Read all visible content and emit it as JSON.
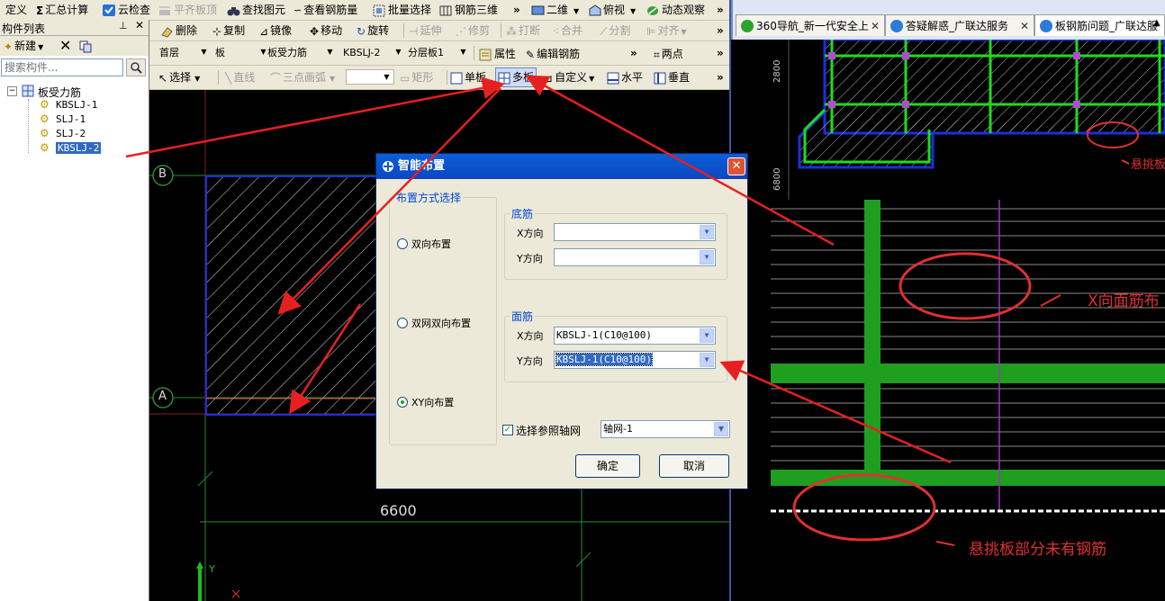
{
  "toolbar_top": {
    "define": "定义",
    "summary_calc": "汇总计算",
    "cloud_check": "云检查",
    "flat_top": "平齐板顶",
    "find_element": "查找图元",
    "view_rebar_qty": "查看钢筋量",
    "batch_select": "批量选择",
    "rebar_3d": "钢筋三维",
    "view_2d": "二维",
    "top_view": "俯视",
    "dynamic_view": "动态观察"
  },
  "toolbar_edit": {
    "delete": "删除",
    "copy": "复制",
    "mirror": "镜像",
    "move": "移动",
    "rotate": "旋转",
    "extend": "延伸",
    "trim": "修剪",
    "break": "打断",
    "merge": "合并",
    "split": "分割",
    "align": "对齐"
  },
  "toolbar_select": {
    "floor": "首层",
    "element_type": "板",
    "element_sub": "板受力筋",
    "element_name": "KBSLJ-2",
    "layer": "分层板1",
    "properties": "属性",
    "edit_rebar": "编辑钢筋",
    "two_points": "两点"
  },
  "toolbar_draw": {
    "select": "选择",
    "line": "直线",
    "three_point_arc": "三点画弧",
    "rect": "矩形",
    "single_slab": "单板",
    "multi_slab": "多板",
    "custom": "自定义",
    "horizontal": "水平",
    "vertical": "垂直"
  },
  "left_panel": {
    "title": "构件列表",
    "pin": "ᅟ",
    "new_button": "新建",
    "search_placeholder": "搜索构件...",
    "tree_root": "板受力筋",
    "tree_items": [
      "KBSLJ-1",
      "SLJ-1",
      "SLJ-2",
      "KBSLJ-2"
    ],
    "selected_index": 3
  },
  "cad": {
    "axis_b": "B",
    "axis_a": "A",
    "dimension": "6600",
    "y_axis": "Y"
  },
  "dialog": {
    "title": "智能布置",
    "method_group": "布置方式选择",
    "radio_bidirectional": "双向布置",
    "radio_double_net": "双网双向布置",
    "radio_xy": "XY向布置",
    "selected_method": "radio_xy",
    "bottom_group": "底筋",
    "top_group": "面筋",
    "x_dir": "X方向",
    "y_dir": "Y方向",
    "bottom_x_value": "",
    "bottom_y_value": "",
    "top_x_value": "KBSLJ-1(C10@100)",
    "top_y_value": "KBSLJ-1(C10@100)",
    "ref_grid_label": "选择参照轴网",
    "ref_grid_checked": true,
    "ref_grid_value": "轴网-1",
    "ok": "确定",
    "cancel": "取消"
  },
  "browser": {
    "tabs": [
      {
        "label": "360导航_新一代安全上"
      },
      {
        "label": "答疑解惑_广联达服务"
      },
      {
        "label": "板钢筋问题_广联达服"
      }
    ],
    "active_tab": 2,
    "dim_2800": "2800",
    "dim_6800": "6800",
    "annot_overhang_short": "悬挑板",
    "annot_x_top": "X向面筋布",
    "annot_overhang_full": "悬挑板部分未有钢筋"
  },
  "colors": {
    "toolbar_bg": "#ece9d8",
    "cad_bg": "#000000",
    "rebar_green": "#1fbd1f",
    "slab_outline": "#1a2fe0",
    "annotation_red": "#e03030",
    "dialog_title": "#0a5fd8"
  }
}
